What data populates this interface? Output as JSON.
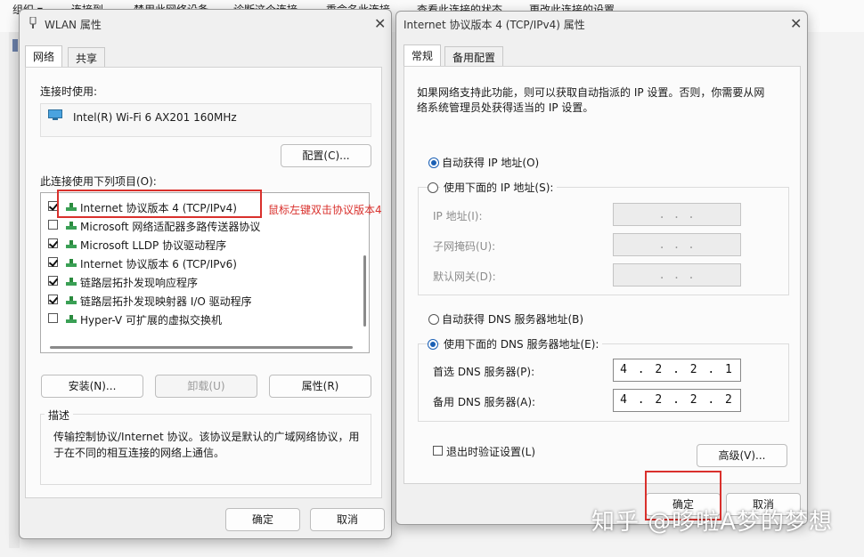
{
  "background": {
    "toolbar_items": [
      "组织 ▾",
      "连接到",
      "禁用此网络设备",
      "诊断这个连接",
      "重命名此连接",
      "查看此连接的状态",
      "更改此连接的设置"
    ]
  },
  "wlan": {
    "title": "WLAN 属性",
    "tabs": [
      "网络",
      "共享"
    ],
    "connect_using_label": "连接时使用:",
    "adapter_name": "Intel(R) Wi-Fi 6 AX201 160MHz",
    "configure_button": "配置(C)...",
    "items_label": "此连接使用下列项目(O):",
    "items": [
      {
        "label": "Internet 协议版本 4 (TCP/IPv4)",
        "checked": true
      },
      {
        "label": "Microsoft 网络适配器多路传送器协议",
        "checked": false
      },
      {
        "label": "Microsoft LLDP 协议驱动程序",
        "checked": true
      },
      {
        "label": "Internet 协议版本 6 (TCP/IPv6)",
        "checked": true
      },
      {
        "label": "链路层拓扑发现响应程序",
        "checked": true
      },
      {
        "label": "链路层拓扑发现映射器 I/O 驱动程序",
        "checked": true
      },
      {
        "label": "Hyper-V 可扩展的虚拟交换机",
        "checked": false
      }
    ],
    "install_button": "安装(N)...",
    "uninstall_button": "卸载(U)",
    "properties_button": "属性(R)",
    "description_title": "描述",
    "description_text_1": "传输控制协议/Internet 协议。该协议是默认的广域网络协议，用",
    "description_text_2": "于在不同的相互连接的网络上通信。",
    "ok_button": "确定",
    "cancel_button": "取消"
  },
  "annotation": "鼠标左键双击协议版本4",
  "ipv4": {
    "title": "Internet 协议版本 4 (TCP/IPv4) 属性",
    "tabs": [
      "常规",
      "备用配置"
    ],
    "intro_1": "如果网络支持此功能，则可以获取自动指派的 IP 设置。否则，你需要从网",
    "intro_2": "络系统管理员处获得适当的 IP 设置。",
    "auto_ip_label": "自动获得 IP 地址(O)",
    "manual_ip_label": "使用下面的 IP 地址(S):",
    "ip_address_label": "IP 地址(I):",
    "subnet_label": "子网掩码(U):",
    "gateway_label": "默认网关(D):",
    "empty_ip": ".   .   .",
    "auto_dns_label": "自动获得 DNS 服务器地址(B)",
    "manual_dns_label": "使用下面的 DNS 服务器地址(E):",
    "preferred_dns_label": "首选 DNS 服务器(P):",
    "preferred_dns_value": "4 . 2 . 2 . 1",
    "alternate_dns_label": "备用 DNS 服务器(A):",
    "alternate_dns_value": "4 . 2 . 2 . 2",
    "validate_label": "退出时验证设置(L)",
    "advanced_button": "高级(V)...",
    "ok_button": "确定",
    "cancel_button": "取消"
  },
  "watermark": "知乎 @哆啦A梦的梦想",
  "colors": {
    "annotation_red": "#d9302c",
    "radio_blue": "#1a5fb4"
  }
}
